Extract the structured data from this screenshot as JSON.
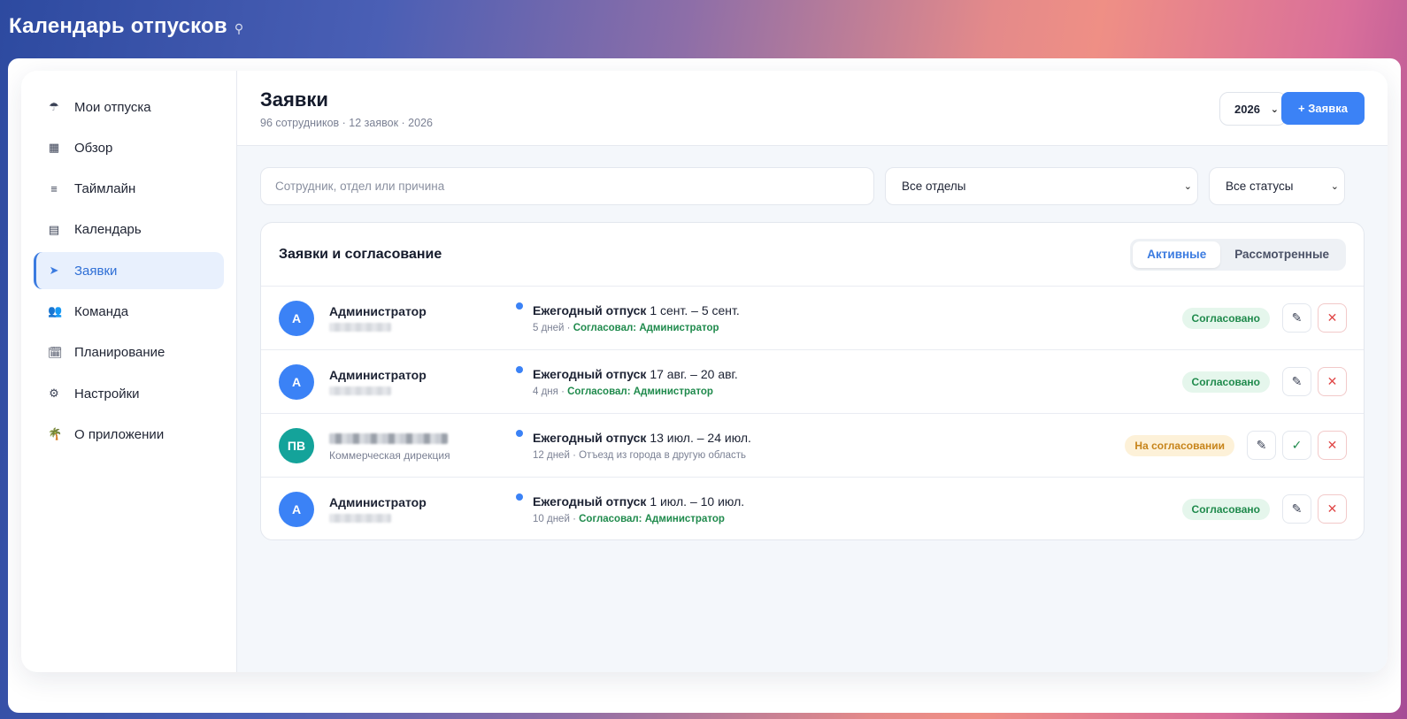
{
  "app": {
    "title": "Календарь отпусков"
  },
  "sidebar": {
    "items": [
      {
        "label": "Мои отпуска",
        "icon": "umbrella-icon",
        "glyph": "☂"
      },
      {
        "label": "Обзор",
        "icon": "grid-icon",
        "glyph": "▦"
      },
      {
        "label": "Таймлайн",
        "icon": "lines-icon",
        "glyph": "≡"
      },
      {
        "label": "Календарь",
        "icon": "calendar-icon",
        "glyph": "▤"
      },
      {
        "label": "Заявки",
        "icon": "send-icon",
        "glyph": "➤",
        "active": true
      },
      {
        "label": "Команда",
        "icon": "team-icon",
        "glyph": "👥"
      },
      {
        "label": "Планирование",
        "icon": "planning-icon",
        "glyph": "🗓"
      },
      {
        "label": "Настройки",
        "icon": "gear-icon",
        "glyph": "⚙"
      },
      {
        "label": "О приложении",
        "icon": "palm-icon",
        "glyph": "🌴"
      }
    ]
  },
  "header": {
    "title": "Заявки",
    "subtitle": "96 сотрудников · 12 заявок · 2026",
    "year": "2026",
    "add_label": "+ Заявка"
  },
  "filters": {
    "search_placeholder": "Сотрудник, отдел или причина",
    "department": "Все отделы",
    "status": "Все статусы"
  },
  "card": {
    "title": "Заявки и согласование",
    "tabs": [
      {
        "label": "Активные",
        "active": true
      },
      {
        "label": "Рассмотренные",
        "active": false
      }
    ]
  },
  "requests": [
    {
      "avatar": "А",
      "avatar_color": "#3b82f6",
      "name": "Администратор",
      "sub": "",
      "type": "Ежегодный отпуск",
      "dates": "1 сент. – 5 сент.",
      "days": "5 дней",
      "note": "Согласовал: Администратор",
      "status": "Согласовано",
      "status_kind": "ok"
    },
    {
      "avatar": "А",
      "avatar_color": "#3b82f6",
      "name": "Администратор",
      "sub": "",
      "type": "Ежегодный отпуск",
      "dates": "17 авг. – 20 авг.",
      "days": "4 дня",
      "note": "Согласовал: Администратор",
      "status": "Согласовано",
      "status_kind": "ok"
    },
    {
      "avatar": "ПВ",
      "avatar_color": "#14a39a",
      "name": "",
      "sub": "Коммерческая дирекция",
      "type": "Ежегодный отпуск",
      "dates": "13 июл. – 24 июл.",
      "days": "12 дней",
      "note": "Отъезд из города в другую область",
      "status": "На согласовании",
      "status_kind": "wait"
    },
    {
      "avatar": "А",
      "avatar_color": "#3b82f6",
      "name": "Администратор",
      "sub": "",
      "type": "Ежегодный отпуск",
      "dates": "1 июл. – 10 июл.",
      "days": "10 дней",
      "note": "Согласовал: Администратор",
      "status": "Согласовано",
      "status_kind": "ok"
    }
  ],
  "colors": {
    "accent": "#3b82f6",
    "success": "#1f8a4c",
    "warning": "#c7841a",
    "danger": "#e04848"
  }
}
